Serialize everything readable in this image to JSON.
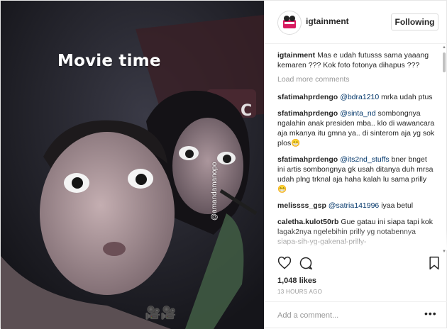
{
  "photo": {
    "caption_overlay": "Movie time",
    "tag_sticker": "@amandamanopo",
    "camera_stickers": "🎥🎥"
  },
  "header": {
    "username": "igtainment",
    "follow_label": "Following"
  },
  "caption": {
    "username": "igtainment",
    "text": "Mas e udah futusss sama yaaang kemaren ??? Kok foto fotonya dihapus ???"
  },
  "load_more": "Load more comments",
  "comments": [
    {
      "username": "sfatimahprdengo",
      "mention": "@bdra1210",
      "text": "mrka udah ptus"
    },
    {
      "username": "sfatimahprdengo",
      "mention": "@sinta_nd",
      "text": "sombongnya ngalahin anak presiden mba.. klo di wawancara aja mkanya itu gmna ya.. di sinterom aja yg sok plos😁"
    },
    {
      "username": "sfatimahprdengo",
      "mention": "@its2nd_stuffs",
      "text": "bner bnget ini artis sombongnya gk usah ditanya duh mrsa udah plng trknal aja haha kalah lu sama prilly😁"
    },
    {
      "username": "melissss_gsp",
      "mention": "@satria141996",
      "text": "iyaa betul"
    },
    {
      "username": "caletha.kulot50rb",
      "mention": "",
      "text": "Gue gatau ini siapa tapi kok lagak2nya ngelebihin prilly yg notabennya siapa-sih-yg-gakenal-prilly-"
    }
  ],
  "likes": "1,048 likes",
  "timestamp": "13 HOURS AGO",
  "add_comment_placeholder": "Add a comment...",
  "icons": {
    "like": "heart-icon",
    "comment": "comment-icon",
    "save": "bookmark-icon",
    "more": "more-options-icon"
  },
  "colors": {
    "mention": "#003569",
    "muted": "#999999",
    "border": "#efefef"
  }
}
